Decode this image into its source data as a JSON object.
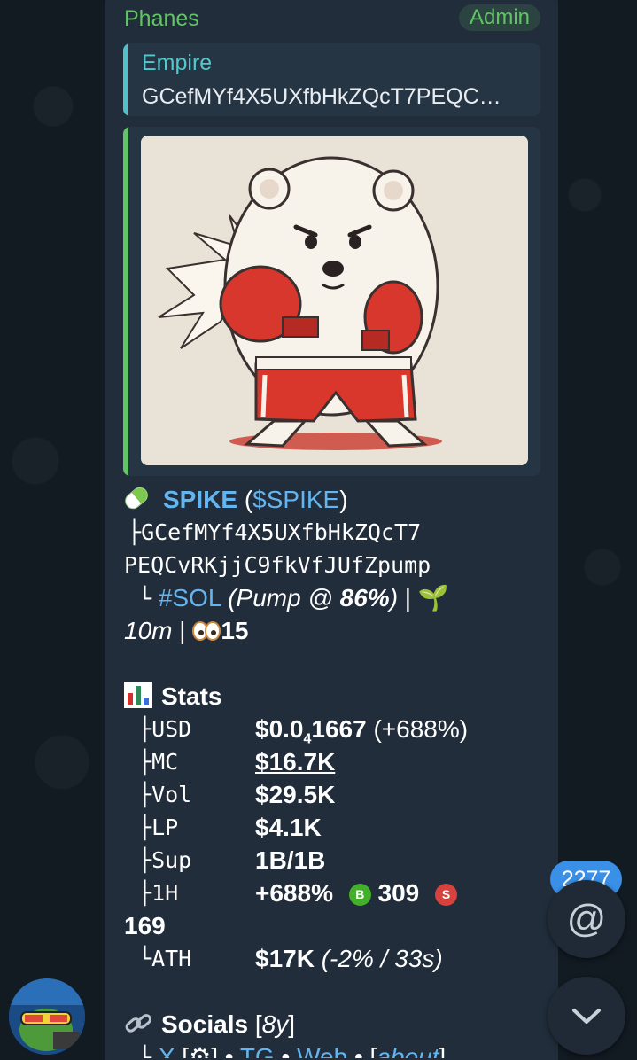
{
  "message": {
    "sender": "Phanes",
    "sender_badge": "Admin",
    "reply": {
      "title": "Empire",
      "text": "GCefMYf4X5UXfbHkZQcT7PEQC…"
    }
  },
  "token": {
    "pill_icon": "pill-icon",
    "name": "SPIKE",
    "ticker": "$SPIKE",
    "address_line1": "GCefMYf4X5UXfbHkZQcT7",
    "address_line2": "PEQCvRKjjC9fkVfJUfZpump",
    "chain_tag": "#SOL",
    "pump_label": "Pump @ ",
    "pump_pct": "86%",
    "age": "10m",
    "views": "15"
  },
  "stats": {
    "heading": "Stats",
    "rows": [
      {
        "key": "USD",
        "value": "$0.0",
        "sub": "4",
        "rest": "1667",
        "extra": " (+688%)"
      },
      {
        "key": "MC",
        "value": "$16.7K"
      },
      {
        "key": "Vol",
        "value": "$29.5K"
      },
      {
        "key": "LP",
        "value": "$4.1K"
      },
      {
        "key": "Sup",
        "value": "1B/1B"
      },
      {
        "key": "1H",
        "value": "+688%",
        "buys": "309",
        "sells": "169"
      }
    ],
    "ath_key": "ATH",
    "ath_value": "$17K",
    "ath_extra": "(-2% / 33s)"
  },
  "socials": {
    "heading": "Socials",
    "age": "8y",
    "links": [
      "X",
      "TG",
      "Web",
      "about"
    ]
  },
  "ui": {
    "unread_mentions": "2277",
    "mention_symbol": "@"
  },
  "colors": {
    "bubble": "#212d3b",
    "link": "#64b5ef",
    "admin": "#62c466",
    "reply_accent": "#4fc3c9",
    "badge": "#3a90e6"
  }
}
